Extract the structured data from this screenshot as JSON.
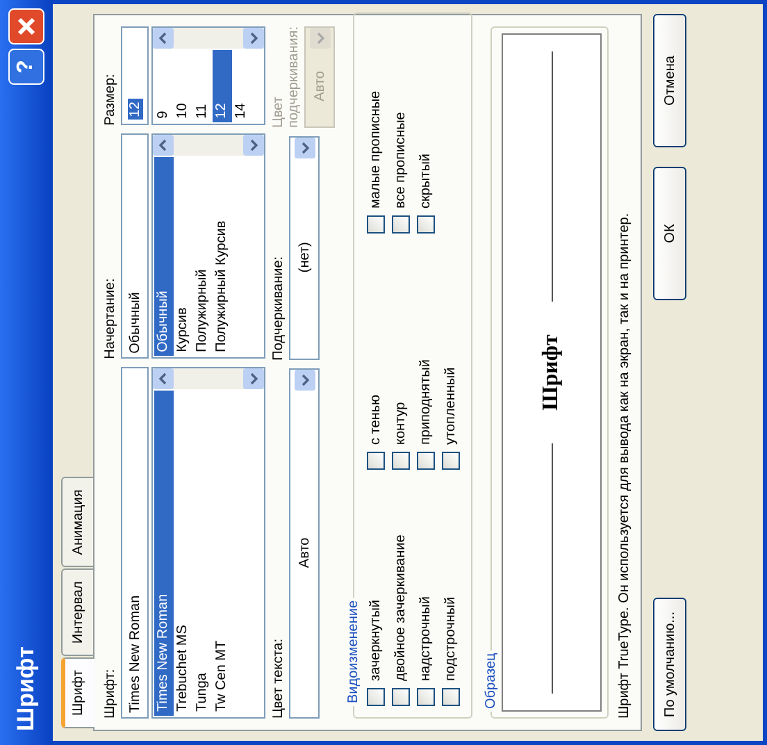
{
  "window": {
    "title": "Шрифт",
    "help": "?"
  },
  "tabs": [
    {
      "label": "Шрифт",
      "selected": true
    },
    {
      "label": "Интервал",
      "selected": false
    },
    {
      "label": "Анимация",
      "selected": false
    }
  ],
  "lists": [
    {
      "label": "Шрифт:",
      "value": "Times New Roman",
      "value_highlighted": false,
      "items": [
        {
          "label": "Times New Roman",
          "selected": true
        },
        {
          "label": "Trebuchet MS",
          "selected": false
        },
        {
          "label": "Tunga",
          "selected": false
        },
        {
          "label": "Tw Cen MT",
          "selected": false
        }
      ]
    },
    {
      "label": "Начертание:",
      "value": "Обычный",
      "value_highlighted": false,
      "items": [
        {
          "label": "Обычный",
          "selected": true
        },
        {
          "label": "Курсив",
          "selected": false
        },
        {
          "label": "Полужирный",
          "selected": false
        },
        {
          "label": "Полужирный Курсив",
          "selected": false
        }
      ]
    },
    {
      "label": "Размер:",
      "value": "12",
      "value_highlighted": true,
      "items": [
        {
          "label": "9",
          "selected": false
        },
        {
          "label": "10",
          "selected": false
        },
        {
          "label": "11",
          "selected": false
        },
        {
          "label": "12",
          "selected": true
        },
        {
          "label": "14",
          "selected": false
        }
      ]
    }
  ],
  "dropdowns": [
    {
      "label": "Цвет текста:",
      "value": "Авто",
      "disabled": false
    },
    {
      "label": "Подчеркивание:",
      "value": "(нет)",
      "disabled": false
    },
    {
      "label": "Цвет подчеркивания:",
      "value": "Авто",
      "disabled": true
    }
  ],
  "effects": {
    "title": "Видоизменение",
    "columns": [
      [
        {
          "label": "зачеркнутый",
          "checked": false
        },
        {
          "label": "двойное зачеркивание",
          "checked": false
        },
        {
          "label": "надстрочный",
          "checked": false
        },
        {
          "label": "подстрочный",
          "checked": false
        }
      ],
      [
        {
          "label": "с тенью",
          "checked": false
        },
        {
          "label": "контур",
          "checked": false
        },
        {
          "label": "приподнятый",
          "checked": false
        },
        {
          "label": "утопленный",
          "checked": false
        }
      ],
      [
        {
          "label": "малые прописные",
          "checked": false
        },
        {
          "label": "все прописные",
          "checked": false
        },
        {
          "label": "скрытый",
          "checked": false
        }
      ]
    ]
  },
  "sample": {
    "title": "Образец",
    "text": "Шрифт"
  },
  "note": "Шрифт TrueType. Он используется для вывода как на экран, так и на принтер.",
  "buttons": [
    {
      "label": "По умолчанию...",
      "kind": "left"
    },
    {
      "label": "ОК",
      "kind": "right"
    },
    {
      "label": "Отмена",
      "kind": "right"
    }
  ]
}
